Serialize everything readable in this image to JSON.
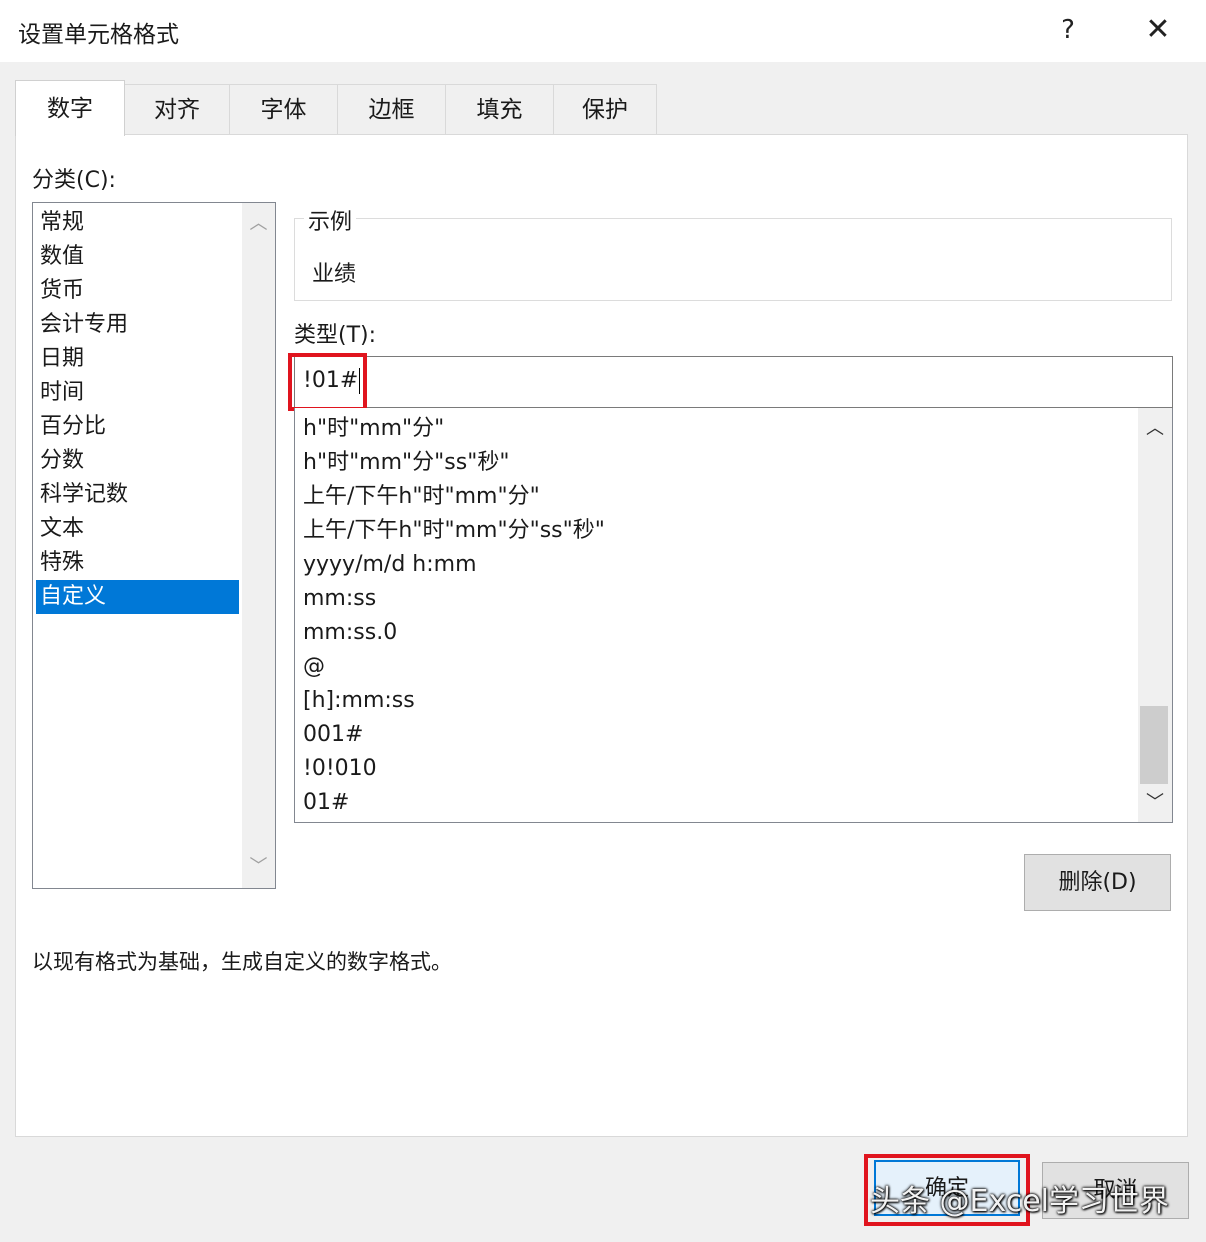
{
  "dialog": {
    "title": "设置单元格格式",
    "help_glyph": "?",
    "close_glyph": "✕"
  },
  "tabs": [
    {
      "label": "数字",
      "active": true
    },
    {
      "label": "对齐"
    },
    {
      "label": "字体"
    },
    {
      "label": "边框"
    },
    {
      "label": "填充"
    },
    {
      "label": "保护"
    }
  ],
  "category": {
    "label": "分类(C):",
    "items": [
      "常规",
      "数值",
      "货币",
      "会计专用",
      "日期",
      "时间",
      "百分比",
      "分数",
      "科学记数",
      "文本",
      "特殊",
      "自定义"
    ],
    "selected": "自定义"
  },
  "sample": {
    "legend": "示例",
    "value": "业绩"
  },
  "type": {
    "label": "类型(T):",
    "value": "!01#",
    "formats": [
      "h\"时\"mm\"分\"",
      "h\"时\"mm\"分\"ss\"秒\"",
      "上午/下午h\"时\"mm\"分\"",
      "上午/下午h\"时\"mm\"分\"ss\"秒\"",
      "yyyy/m/d h:mm",
      "mm:ss",
      "mm:ss.0",
      "@",
      "[h]:mm:ss",
      "001#",
      "!0!010",
      "01#"
    ]
  },
  "buttons": {
    "delete": "删除(D)",
    "ok": "确定",
    "cancel": "取消"
  },
  "description": "以现有格式为基础，生成自定义的数字格式。",
  "watermark": "头条 @Excel学习世界",
  "colors": {
    "selection": "#0078d7",
    "highlight": "#e0141e"
  }
}
